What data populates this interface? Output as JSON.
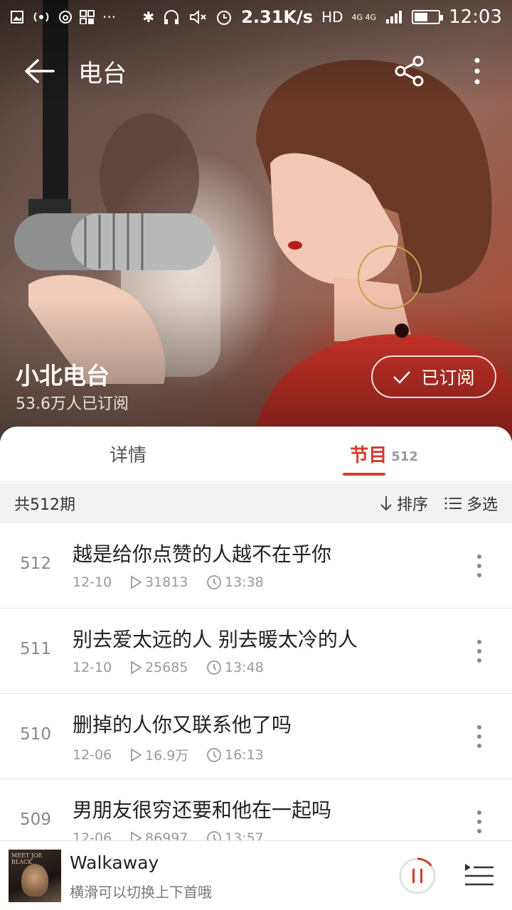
{
  "statusbar": {
    "speed": "2.31K/s",
    "hd": "HD",
    "network": "4G 4G",
    "time": "12:03",
    "battery_level": 0.55
  },
  "header": {
    "title": "电台"
  },
  "station": {
    "name": "小北电台",
    "subscribers": "53.6万人已订阅",
    "subscribe_label": "已订阅"
  },
  "tabs": [
    {
      "label": "详情",
      "count": ""
    },
    {
      "label": "节目",
      "count": "512"
    }
  ],
  "toolbar": {
    "total": "共512期",
    "sort_label": "排序",
    "multi_label": "多选"
  },
  "episodes": [
    {
      "num": "512",
      "title": "越是给你点赞的人越不在乎你",
      "date": "12-10",
      "plays": "31813",
      "duration": "13:38"
    },
    {
      "num": "511",
      "title": "别去爱太远的人 别去暖太冷的人",
      "date": "12-10",
      "plays": "25685",
      "duration": "13:48"
    },
    {
      "num": "510",
      "title": "删掉的人你又联系他了吗",
      "date": "12-06",
      "plays": "16.9万",
      "duration": "16:13"
    },
    {
      "num": "509",
      "title": "男朋友很穷还要和他在一起吗",
      "date": "12-06",
      "plays": "86997",
      "duration": "13:57"
    }
  ],
  "player": {
    "track_title": "Walkaway",
    "subtitle": "横滑可以切换上下首哦",
    "cover_text": "MEET JOE BLACK",
    "progress": 0.15
  },
  "colors": {
    "accent": "#d33a31"
  }
}
